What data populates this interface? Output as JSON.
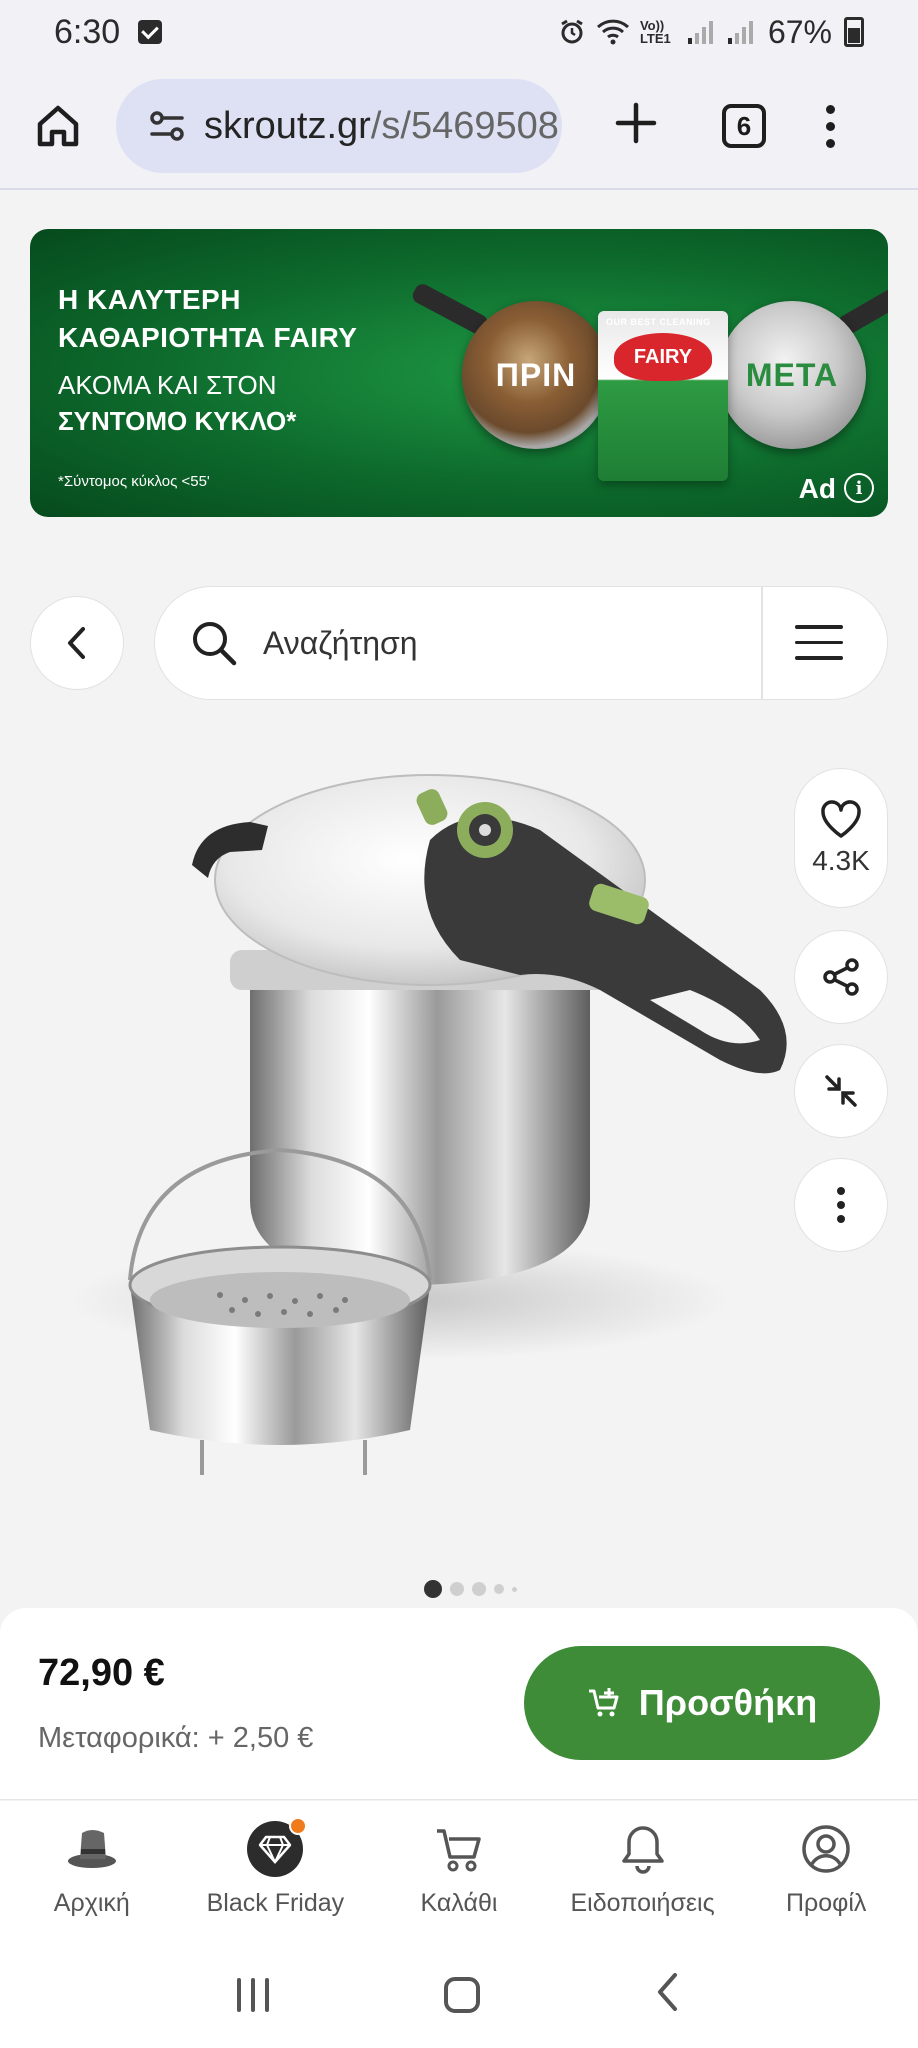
{
  "status_bar": {
    "time": "6:30",
    "network": "Vo)) LTE1",
    "battery_percent": "67%"
  },
  "browser": {
    "url_host": "skroutz.gr",
    "url_path": "/s/5469508",
    "tab_count": "6",
    "icons": [
      "home-icon",
      "site-settings-icon",
      "plus-icon",
      "tabs-icon",
      "overflow-menu-icon"
    ]
  },
  "ad": {
    "headline_line1": "Η ΚΑΛΥΤΕΡΗ",
    "headline_line2": "ΚΑΘΑΡΙΟΤΗΤΑ FAIRY",
    "sub_line1": "ΑΚΟΜΑ ΚΑΙ ΣΤΟΝ",
    "sub_line2": "ΣΥΝΤΟΜΟ ΚΥΚΛΟ*",
    "note": "*Σύντομος κύκλος <55'",
    "before_label": "ΠΡΙΝ",
    "after_label": "ΜΕΤΑ",
    "pack_top": "OUR BEST CLEANING",
    "brand": "FAIRY",
    "ad_label": "Ad",
    "info_glyph": "i"
  },
  "search": {
    "placeholder": "Αναζήτηση"
  },
  "product": {
    "likes": "4.3K",
    "carousel_total": 5,
    "carousel_active": 1
  },
  "purchase": {
    "price": "72,90 €",
    "shipping": "Μεταφορικά: + 2,50 €",
    "add_label": "Προσθήκη"
  },
  "bottom_nav": {
    "items": [
      {
        "label": "Αρχική",
        "icon": "home-hat-icon"
      },
      {
        "label": "Black Friday",
        "icon": "diamond-icon"
      },
      {
        "label": "Καλάθι",
        "icon": "cart-icon"
      },
      {
        "label": "Ειδοποιήσεις",
        "icon": "bell-icon"
      },
      {
        "label": "Προφίλ",
        "icon": "profile-icon"
      }
    ]
  },
  "colors": {
    "accent_green": "#3e8b38",
    "ad_green": "#0d6a2c",
    "notification_orange": "#f07b1d"
  }
}
